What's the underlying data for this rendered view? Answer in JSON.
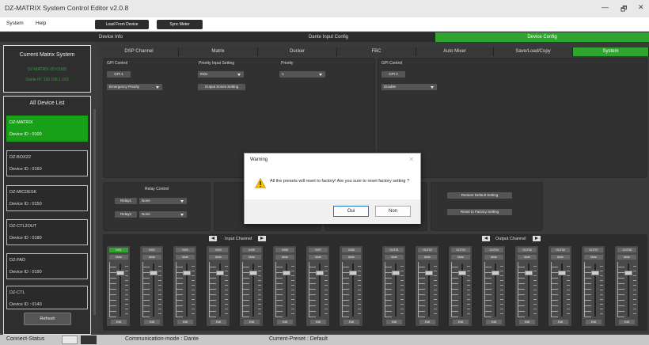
{
  "window": {
    "title": "DZ-MATRIX System Control Editor v2.0.8",
    "minimize": "—",
    "restore": "🗗",
    "close": "✕"
  },
  "menu": {
    "system": "System",
    "help": "Help",
    "load_from_device": "Load From Device",
    "sync_meter": "Sync Meter"
  },
  "top_tabs": [
    "Device Info",
    "Dante Input Config",
    "Device Config"
  ],
  "sub_tabs": [
    "DSP Channel",
    "Matrix",
    "Ducker",
    "FBC",
    "Auto Mixer",
    "Save/Load/Copy",
    "System"
  ],
  "sidebar": {
    "current_title": "Current Matrix System",
    "current_name": "DZ-MATRIX (ID:0100)",
    "current_ip": "Dante IP: 192.168.1.153",
    "list_title": "All Device List",
    "devices": [
      {
        "name": "DZ-MATRIX",
        "id": "Device ID : 0100",
        "selected": true
      },
      {
        "name": "DZ-BOX22",
        "id": "Device ID : 0160",
        "selected": false
      },
      {
        "name": "DZ-MICDESK",
        "id": "Device ID : 0150",
        "selected": false
      },
      {
        "name": "DZ-CTL2OUT",
        "id": "Device ID : 0180",
        "selected": false
      },
      {
        "name": "DZ-PAD",
        "id": "Device ID : 0190",
        "selected": false
      },
      {
        "name": "DZ-CTL",
        "id": "Device ID : 0140",
        "selected": false
      }
    ],
    "refresh": "Refresh"
  },
  "gpi1": {
    "control_label": "GPI Control",
    "gpi_button": "GPI 1",
    "mode": "Emergency Priority",
    "priority_input_label": "Priority Input Setting",
    "priority_input": "IN01",
    "output_zones": "Output Zones Setting",
    "priority_label": "Priority",
    "priority": "1"
  },
  "gpi2": {
    "control_label": "GPI Control",
    "gpi_button": "GPI 2",
    "mode": "Disable"
  },
  "relay": {
    "title": "Relay Control",
    "relay1": "Relay1",
    "relay1_value": "None",
    "relay2": "Relay2",
    "relay2_value": "None"
  },
  "factory": {
    "restore": "Restore Default Setting",
    "reset": "Reset to Factory Setting"
  },
  "channels": {
    "input_title": "Input Channel",
    "output_title": "Output Channel",
    "inputs": [
      "IN01",
      "IN02",
      "IN03",
      "IN04",
      "IN05",
      "IN06",
      "IN07",
      "IN08"
    ],
    "outputs": [
      "OUT01",
      "OUT02",
      "OUT03",
      "OUT04",
      "OUT05",
      "OUT06",
      "OUT07",
      "OUT08"
    ],
    "mute": "Mute",
    "edit": "Edit"
  },
  "status": {
    "connect": "Connect-Status",
    "mode": "Communication-mode : Dante",
    "preset": "Current-Preset : Default"
  },
  "dialog": {
    "title": "Warning",
    "message": "All the presets will reset to factory! Are you sure to reset factory setting ?",
    "yes": "Oui",
    "no": "Non",
    "close": "✕"
  },
  "colors": {
    "accent": "#2ea52e",
    "background": "#3a3a3a"
  }
}
